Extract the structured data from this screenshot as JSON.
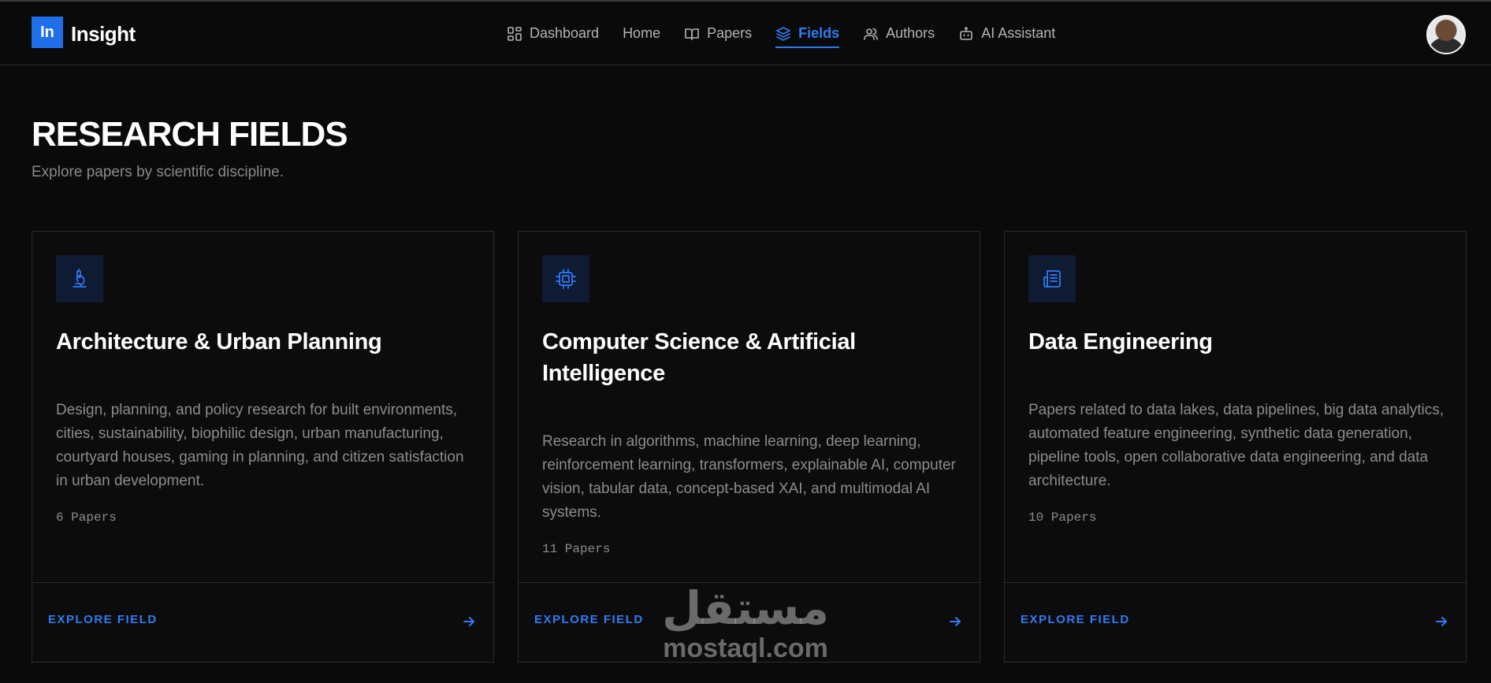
{
  "brand": {
    "logo_mark": "In",
    "name": "Insight"
  },
  "nav": [
    {
      "label": "Dashboard",
      "icon": "grid-icon",
      "active": false
    },
    {
      "label": "Home",
      "icon": "",
      "active": false
    },
    {
      "label": "Papers",
      "icon": "book-icon",
      "active": false
    },
    {
      "label": "Fields",
      "icon": "layers-icon",
      "active": true
    },
    {
      "label": "Authors",
      "icon": "users-icon",
      "active": false
    },
    {
      "label": "AI Assistant",
      "icon": "bot-icon",
      "active": false
    }
  ],
  "page": {
    "title": "RESEARCH FIELDS",
    "subtitle": "Explore papers by scientific discipline."
  },
  "cards": [
    {
      "icon": "microscope-icon",
      "title": "Architecture & Urban Planning",
      "description": "Design, planning, and policy research for built environments, cities, sustainability, biophilic design, urban manufacturing, courtyard houses, gaming in planning, and citizen satisfaction in urban development.",
      "count": "6 Papers",
      "link": "EXPLORE FIELD"
    },
    {
      "icon": "cpu-icon",
      "title": "Computer Science & Artificial Intelligence",
      "description": "Research in algorithms, machine learning, deep learning, reinforcement learning, transformers, explainable AI, computer vision, tabular data, concept-based XAI, and multimodal AI systems.",
      "count": "11 Papers",
      "link": "EXPLORE FIELD"
    },
    {
      "icon": "newspaper-icon",
      "title": "Data Engineering",
      "description": "Papers related to data lakes, data pipelines, big data analytics, automated feature engineering, synthetic data generation, pipeline tools, open collaborative data engineering, and data architecture.",
      "count": "10 Papers",
      "link": "EXPLORE FIELD"
    }
  ],
  "watermark": {
    "arabic": "مستقل",
    "latin": "mostaql.com"
  },
  "colors": {
    "accent": "#2f7cf6",
    "background": "#0a0a0a",
    "card_border": "#2c2c2c"
  }
}
